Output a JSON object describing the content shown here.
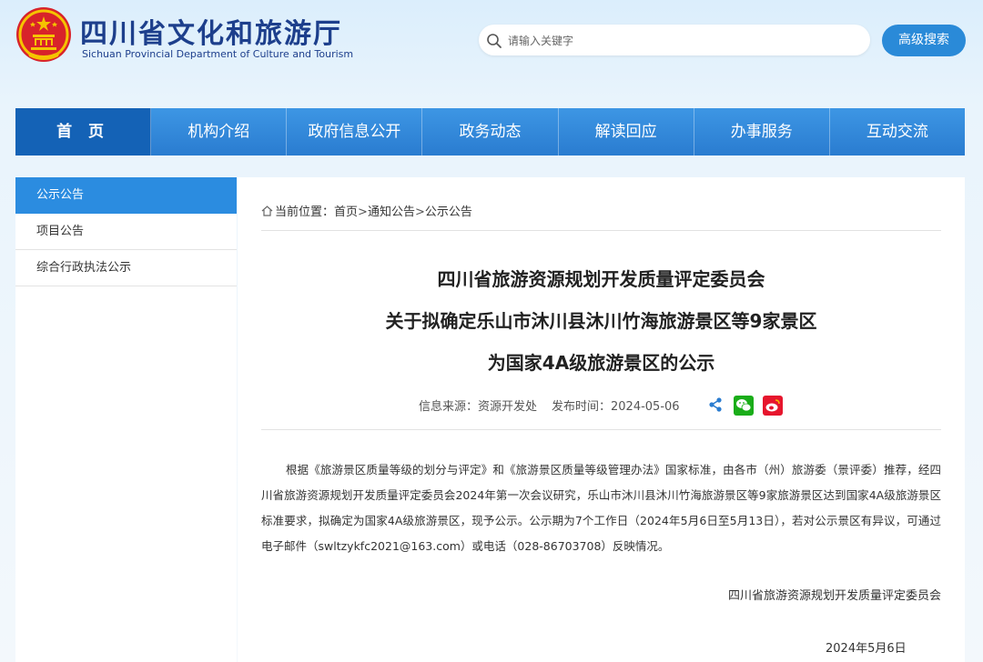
{
  "header": {
    "title": "四川省文化和旅游厅",
    "subtitle": "Sichuan Provincial Department of Culture and Tourism",
    "search_placeholder": "请输入关键字",
    "advanced_search": "高级搜索"
  },
  "nav": {
    "items": [
      "首 页",
      "机构介绍",
      "政府信息公开",
      "政务动态",
      "解读回应",
      "办事服务",
      "互动交流"
    ]
  },
  "sidebar": {
    "items": [
      "公示公告",
      "项目公告",
      "综合行政执法公示"
    ]
  },
  "breadcrumb": {
    "label": "当前位置：",
    "items": [
      "首页",
      "通知公告",
      "公示公告"
    ],
    "separator": ">"
  },
  "article": {
    "title_lines": [
      "四川省旅游资源规划开发质量评定委员会",
      "关于拟确定乐山市沐川县沐川竹海旅游景区等9家景区",
      "为国家4A级旅游景区的公示"
    ],
    "source": "信息来源：资源开发处",
    "publish_time": "发布时间：2024-05-06",
    "body": "根据《旅游景区质量等级的划分与评定》和《旅游景区质量等级管理办法》国家标准，由各市（州）旅游委（景评委）推荐，经四川省旅游资源规划开发质量评定委员会2024年第一次会议研究，乐山市沐川县沐川竹海旅游景区等9家旅游景区达到国家4A级旅游景区标准要求，拟确定为国家4A级旅游景区，现予公示。公示期为7个工作日（2024年5月6日至5月13日），若对公示景区有异议，可通过电子邮件（swltzykfc2021@163.com）或电话（028-86703708）反映情况。",
    "signature_org": "四川省旅游资源规划开发质量评定委员会",
    "signature_date": "2024年5月6日"
  },
  "icons": {
    "share": "share-icon",
    "wechat": "wechat-icon",
    "weibo": "weibo-icon",
    "home": "home-icon",
    "search": "search-icon"
  },
  "colors": {
    "brand_blue": "#1d3f8c",
    "nav_blue": "#2a7cd0",
    "nav_active": "#1462b6",
    "wechat_green": "#1aad19",
    "weibo_red": "#e6162d"
  }
}
